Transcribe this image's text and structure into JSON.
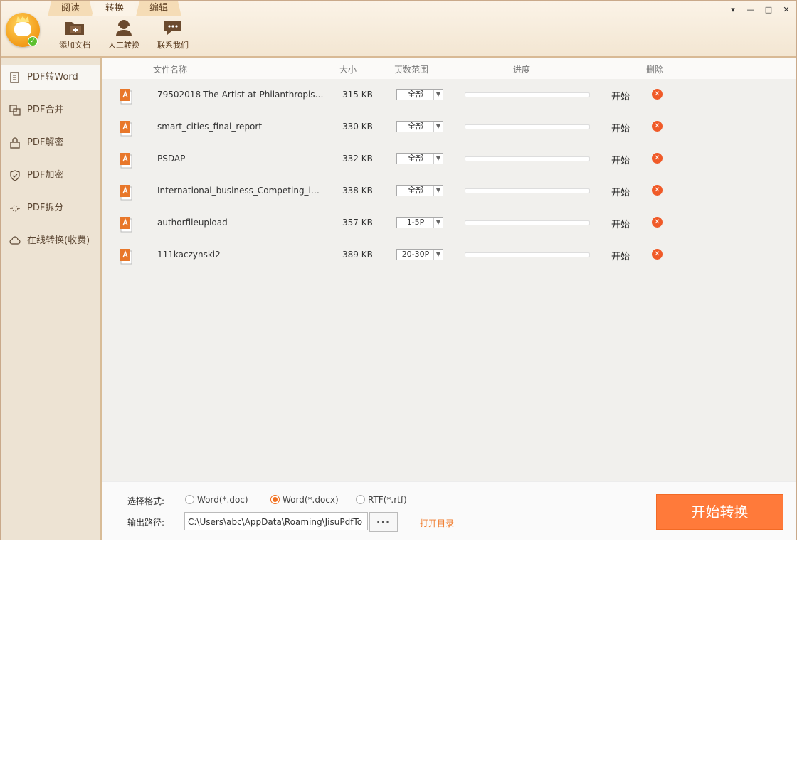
{
  "app": {
    "tabs": [
      "阅读",
      "转换",
      "编辑"
    ],
    "active_tab": "转换",
    "toolbar": [
      {
        "label": "添加文档",
        "icon": "add-folder-icon"
      },
      {
        "label": "人工转换",
        "icon": "support-agent-icon"
      },
      {
        "label": "联系我们",
        "icon": "chat-bubble-icon"
      }
    ],
    "window_controls": [
      "▾",
      "—",
      "□",
      "✕"
    ]
  },
  "sidebar": {
    "items": [
      {
        "label": "PDF转Word",
        "icon": "pdf-to-word-icon",
        "active": true
      },
      {
        "label": "PDF合并",
        "icon": "merge-icon",
        "active": false
      },
      {
        "label": "PDF解密",
        "icon": "unlock-icon",
        "active": false
      },
      {
        "label": "PDF加密",
        "icon": "shield-icon",
        "active": false
      },
      {
        "label": "PDF拆分",
        "icon": "split-icon",
        "active": false
      },
      {
        "label": "在线转换(收费)",
        "icon": "cloud-icon",
        "active": false
      }
    ]
  },
  "table": {
    "headers": {
      "name": "文件名称",
      "size": "大小",
      "range": "页数范围",
      "progress": "进度",
      "delete": "删除"
    },
    "rows": [
      {
        "name": "79502018-The-Artist-at-Philanthropist-...",
        "size": "315 KB",
        "range": "全部",
        "progress": 0,
        "action": "开始"
      },
      {
        "name": "smart_cities_final_report",
        "size": "330 KB",
        "range": "全部",
        "progress": 0,
        "action": "开始"
      },
      {
        "name": "PSDAP",
        "size": "332 KB",
        "range": "全部",
        "progress": 0,
        "action": "开始"
      },
      {
        "name": "International_business_Competing_in_t...",
        "size": "338 KB",
        "range": "全部",
        "progress": 0,
        "action": "开始"
      },
      {
        "name": "authorfileupload",
        "size": "357 KB",
        "range": "1-5P",
        "progress": 0,
        "action": "开始"
      },
      {
        "name": "111kaczynski2",
        "size": "389 KB",
        "range": "20-30P",
        "progress": 0,
        "action": "开始"
      }
    ]
  },
  "bottom": {
    "format_label": "选择格式:",
    "formats": [
      {
        "label": "Word(*.doc)",
        "selected": false
      },
      {
        "label": "Word(*.docx)",
        "selected": true
      },
      {
        "label": "RTF(*.rtf)",
        "selected": false
      }
    ],
    "path_label": "输出路径:",
    "path_value": "C:\\Users\\abc\\AppData\\Roaming\\JisuPdfTo",
    "browse_label": "···",
    "open_dir": "打开目录",
    "start_button": "开始转换"
  },
  "colors": {
    "accent": "#ff7a3a",
    "delete": "#f05a28",
    "pdf_icon": "#e8772a"
  }
}
